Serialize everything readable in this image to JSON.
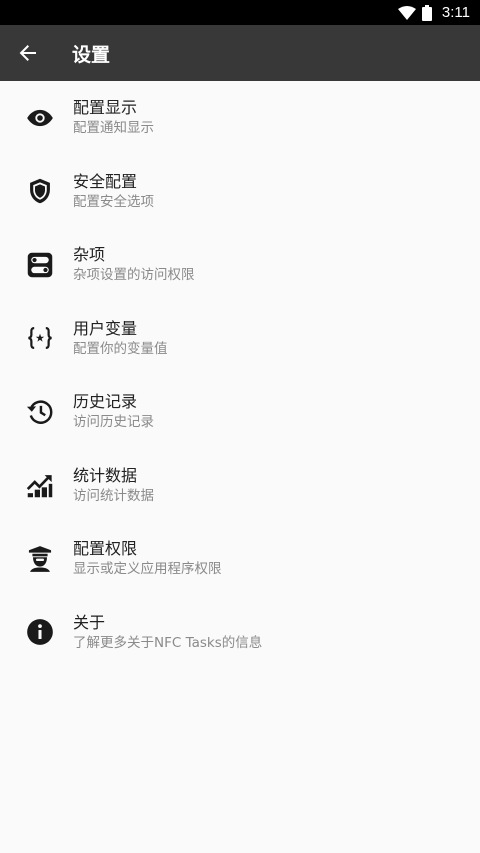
{
  "status_bar": {
    "time": "3:11"
  },
  "app_bar": {
    "title": "设置",
    "back_icon": "arrow-back-icon"
  },
  "settings": [
    {
      "icon": "eye-icon",
      "title": "配置显示",
      "subtitle": "配置通知显示"
    },
    {
      "icon": "shield-icon",
      "title": "安全配置",
      "subtitle": "配置安全选项"
    },
    {
      "icon": "toggles-icon",
      "title": "杂项",
      "subtitle": "杂项设置的访问权限"
    },
    {
      "icon": "variable-braces-icon",
      "title": "用户变量",
      "subtitle": "配置你的变量值"
    },
    {
      "icon": "history-icon",
      "title": "历史记录",
      "subtitle": "访问历史记录"
    },
    {
      "icon": "chart-icon",
      "title": "统计数据",
      "subtitle": "访问统计数据"
    },
    {
      "icon": "police-badge-icon",
      "title": "配置权限",
      "subtitle": "显示或定义应用程序权限"
    },
    {
      "icon": "info-icon",
      "title": "关于",
      "subtitle": "了解更多关于NFC Tasks的信息"
    }
  ]
}
